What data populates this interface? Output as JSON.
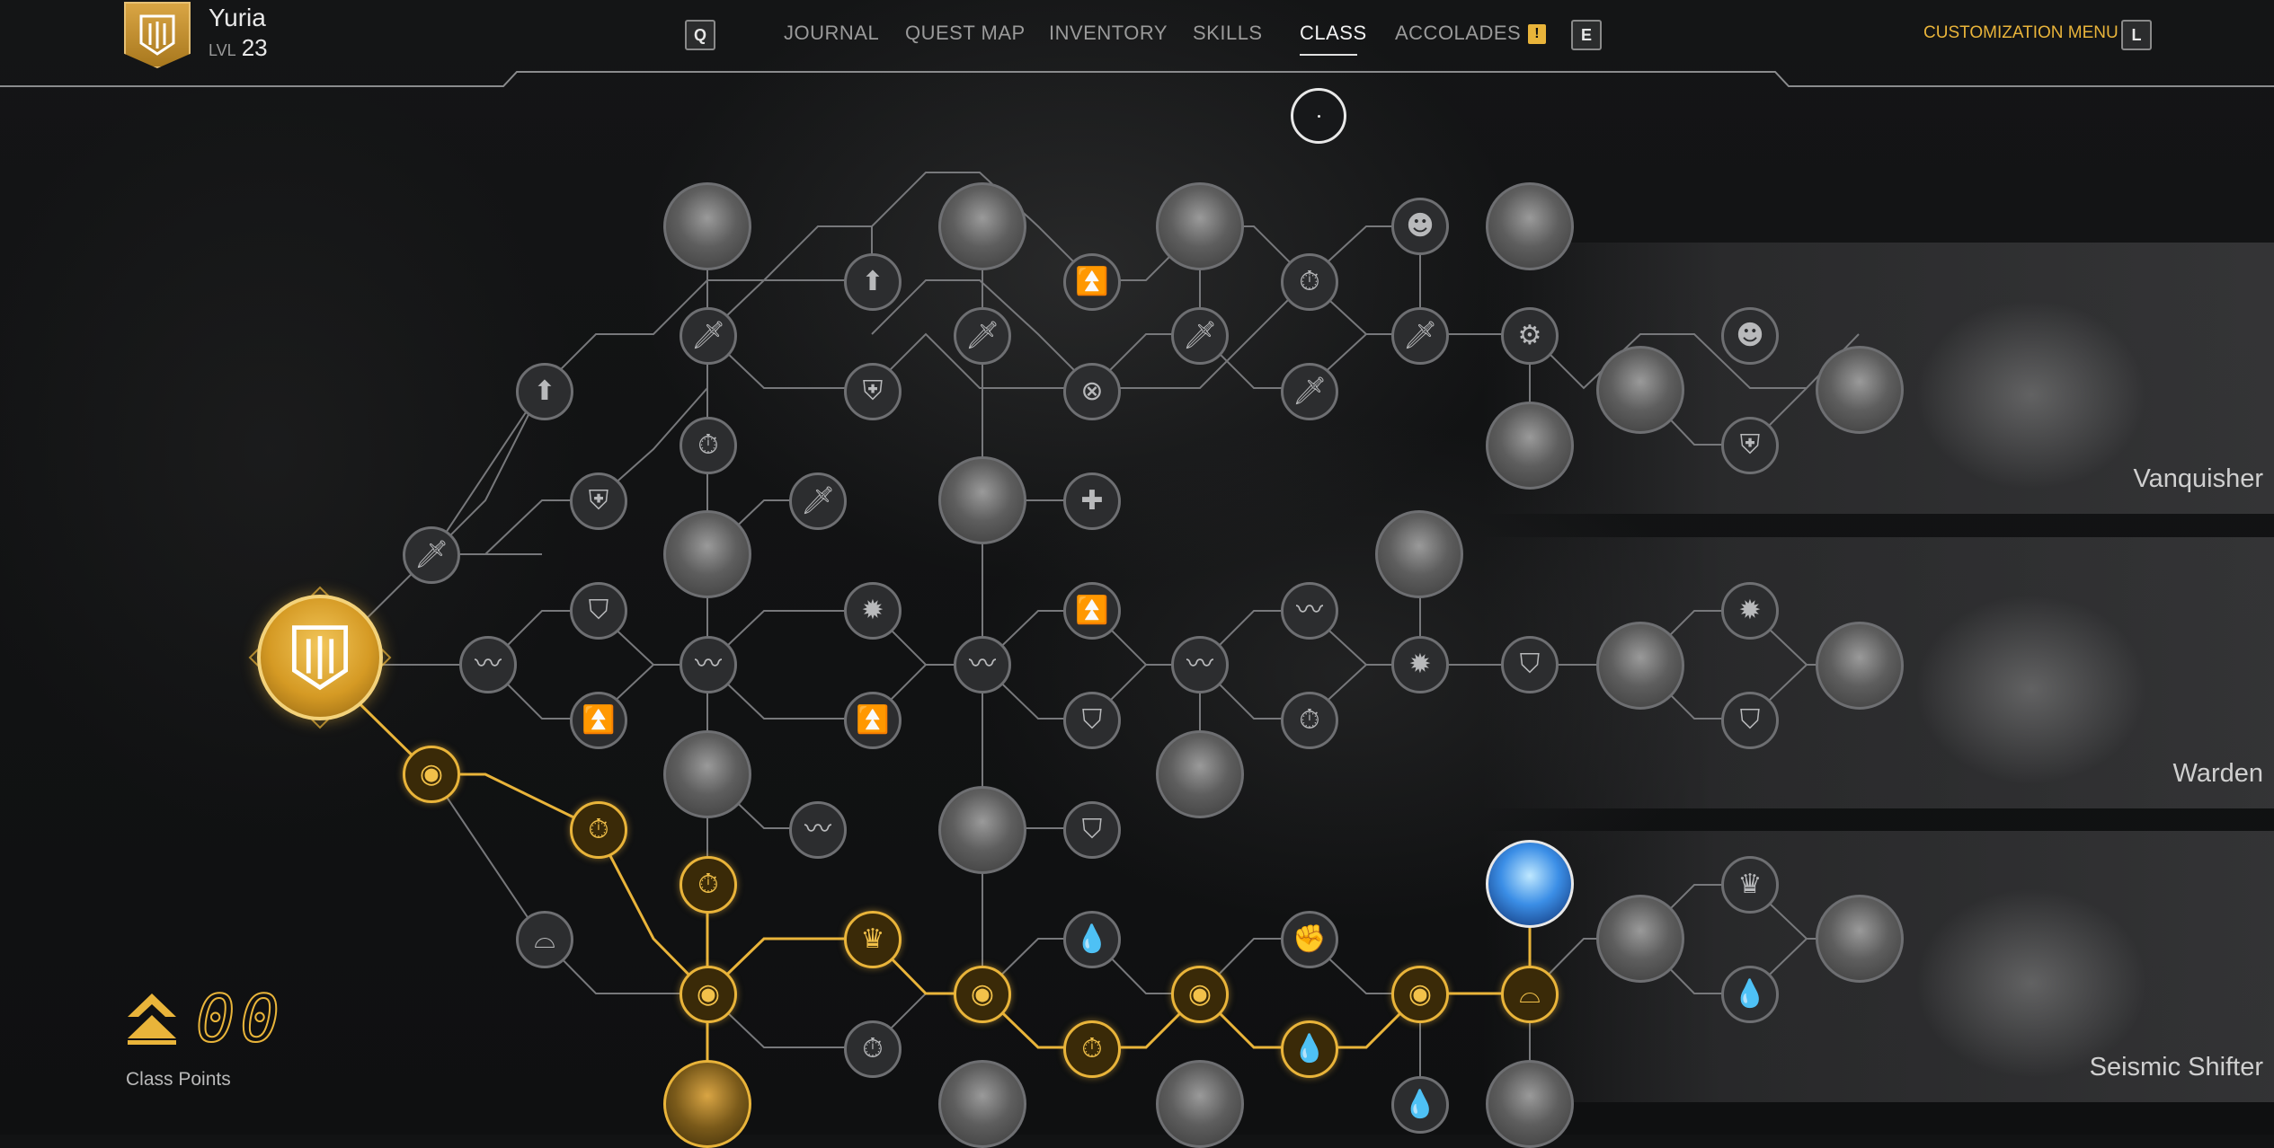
{
  "player": {
    "name": "Yuria",
    "level_label": "LVL",
    "level": "23"
  },
  "nav": {
    "prev_key": "Q",
    "next_key": "E",
    "tabs": [
      "JOURNAL",
      "QUEST MAP",
      "INVENTORY",
      "SKILLS",
      "CLASS",
      "ACCOLADES"
    ],
    "active_tab": "CLASS",
    "accolades_badge": "!",
    "customization_label": "CUSTOMIZATION MENU",
    "customization_key": "L"
  },
  "classes": [
    {
      "name": "Vanquisher"
    },
    {
      "name": "Warden"
    },
    {
      "name": "Seismic Shifter"
    }
  ],
  "class_points": {
    "value": "00",
    "label": "Class Points"
  },
  "colors": {
    "accent": "#e9b43a",
    "inactive_node": "#6e6f72",
    "background": "#121314"
  }
}
